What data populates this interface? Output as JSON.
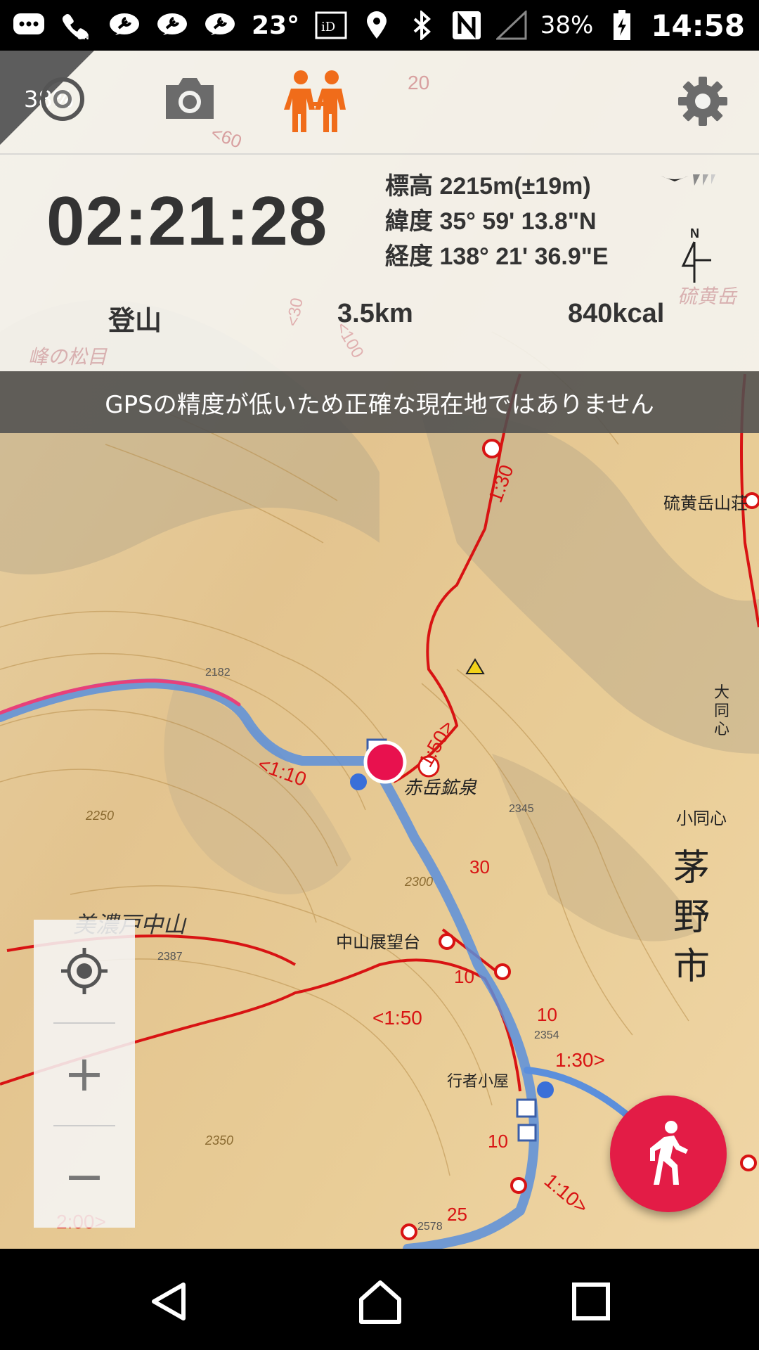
{
  "status_bar": {
    "temperature": "23°",
    "battery": "38%",
    "time": "14:58",
    "icons": [
      "messages-icon",
      "wifi-calling-icon",
      "maintenance-icon",
      "maintenance-icon",
      "maintenance-icon",
      "id-icon",
      "location-icon",
      "bluetooth-icon",
      "nfc-icon",
      "signal-icon",
      "battery-charging-icon"
    ]
  },
  "toolbar": {
    "battery_badge": "38%",
    "camera_icon": "camera-icon",
    "companion_icon": "companions-icon",
    "settings_icon": "gear-icon"
  },
  "tracking": {
    "elapsed": "02:21:28",
    "altitude_label": "標高",
    "altitude_value": "2215m(±19m)",
    "latitude_label": "緯度",
    "latitude_value": "35° 59' 13.8\"N",
    "longitude_label": "経度",
    "longitude_value": "138° 21' 36.9\"E",
    "compass_north": "N"
  },
  "stats": {
    "activity": "登山",
    "distance": "3.5km",
    "calories": "840kcal"
  },
  "banner": {
    "message": "GPSの精度が低いため正確な現在地ではありません"
  },
  "map": {
    "labels": {
      "sulfur_hut": "硫黄岳山荘",
      "akadake_spring": "赤岳鉱泉",
      "nakayama_view": "中山展望台",
      "mino_nakayama": "美濃戸中山",
      "gyoja_hut": "行者小屋",
      "odoshin": "大同心",
      "kodoshin": "小同心",
      "chino_1": "茅",
      "chino_2": "野",
      "chino_3": "市",
      "time_150_a": "1:50>",
      "time_110": "<1:10",
      "time_150_b": "<1:50",
      "time_130_top": "1:30",
      "time_130_b": "1:30>",
      "time_200": "2:00>",
      "time_110_b": "1:10>",
      "seg_30": "30",
      "seg_10a": "10",
      "seg_10b": "10",
      "seg_10c": "10",
      "seg_25": "25",
      "elev_2182": "2182",
      "elev_2345": "2345",
      "elev_2387": "2387",
      "elev_2354": "2354",
      "elev_2300": "2300",
      "elev_2250": "2250",
      "elev_2350": "2350",
      "elev_2578": "2578",
      "elev_20": "20",
      "elev_60": "<60",
      "iodake": "硫黄岳",
      "minenomatsume": "峰の松目",
      "seg_100": "<100",
      "seg_30_top": "<30"
    }
  },
  "zoom": {
    "locate_icon": "my-location-icon",
    "plus": "+",
    "minus": "−"
  },
  "fab": {
    "icon": "walking-person-icon"
  },
  "navbar": {
    "back_icon": "back-icon",
    "home_icon": "home-icon",
    "recents_icon": "recents-icon"
  }
}
